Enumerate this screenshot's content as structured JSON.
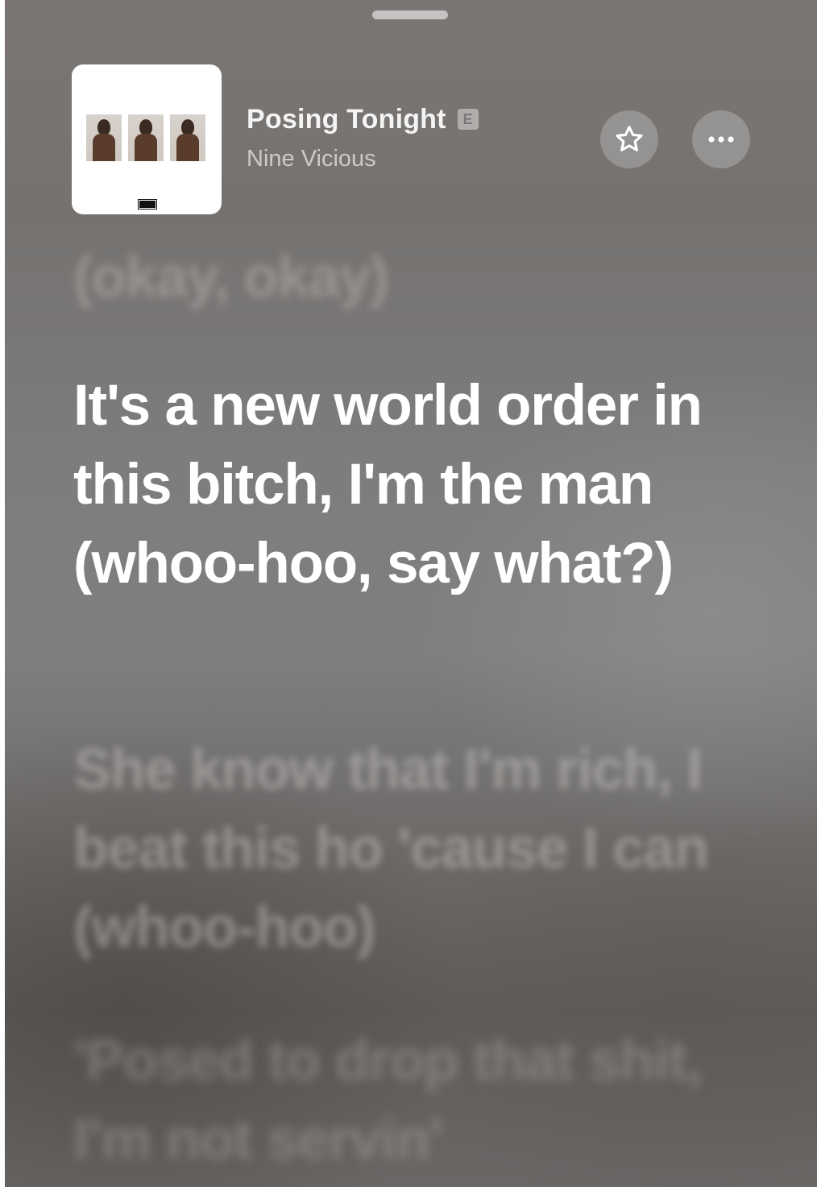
{
  "now_playing": {
    "title": "Posing Tonight",
    "explicit_badge": "E",
    "artist": "Nine Vicious",
    "actions": {
      "favorite_icon": "star-icon",
      "more_icon": "ellipsis-icon"
    }
  },
  "lyrics": {
    "previous": "(okay, okay)",
    "current": "It's a new world order in this bitch, I'm the man (whoo-hoo, say what?)",
    "next": "She know that I'm rich, I beat this ho 'cause I can (whoo-hoo)",
    "after": "'Posed to drop that shit, I'm not servin'"
  },
  "colors": {
    "current_lyric": "#ffffff",
    "background_gray": "#7c7a79"
  }
}
